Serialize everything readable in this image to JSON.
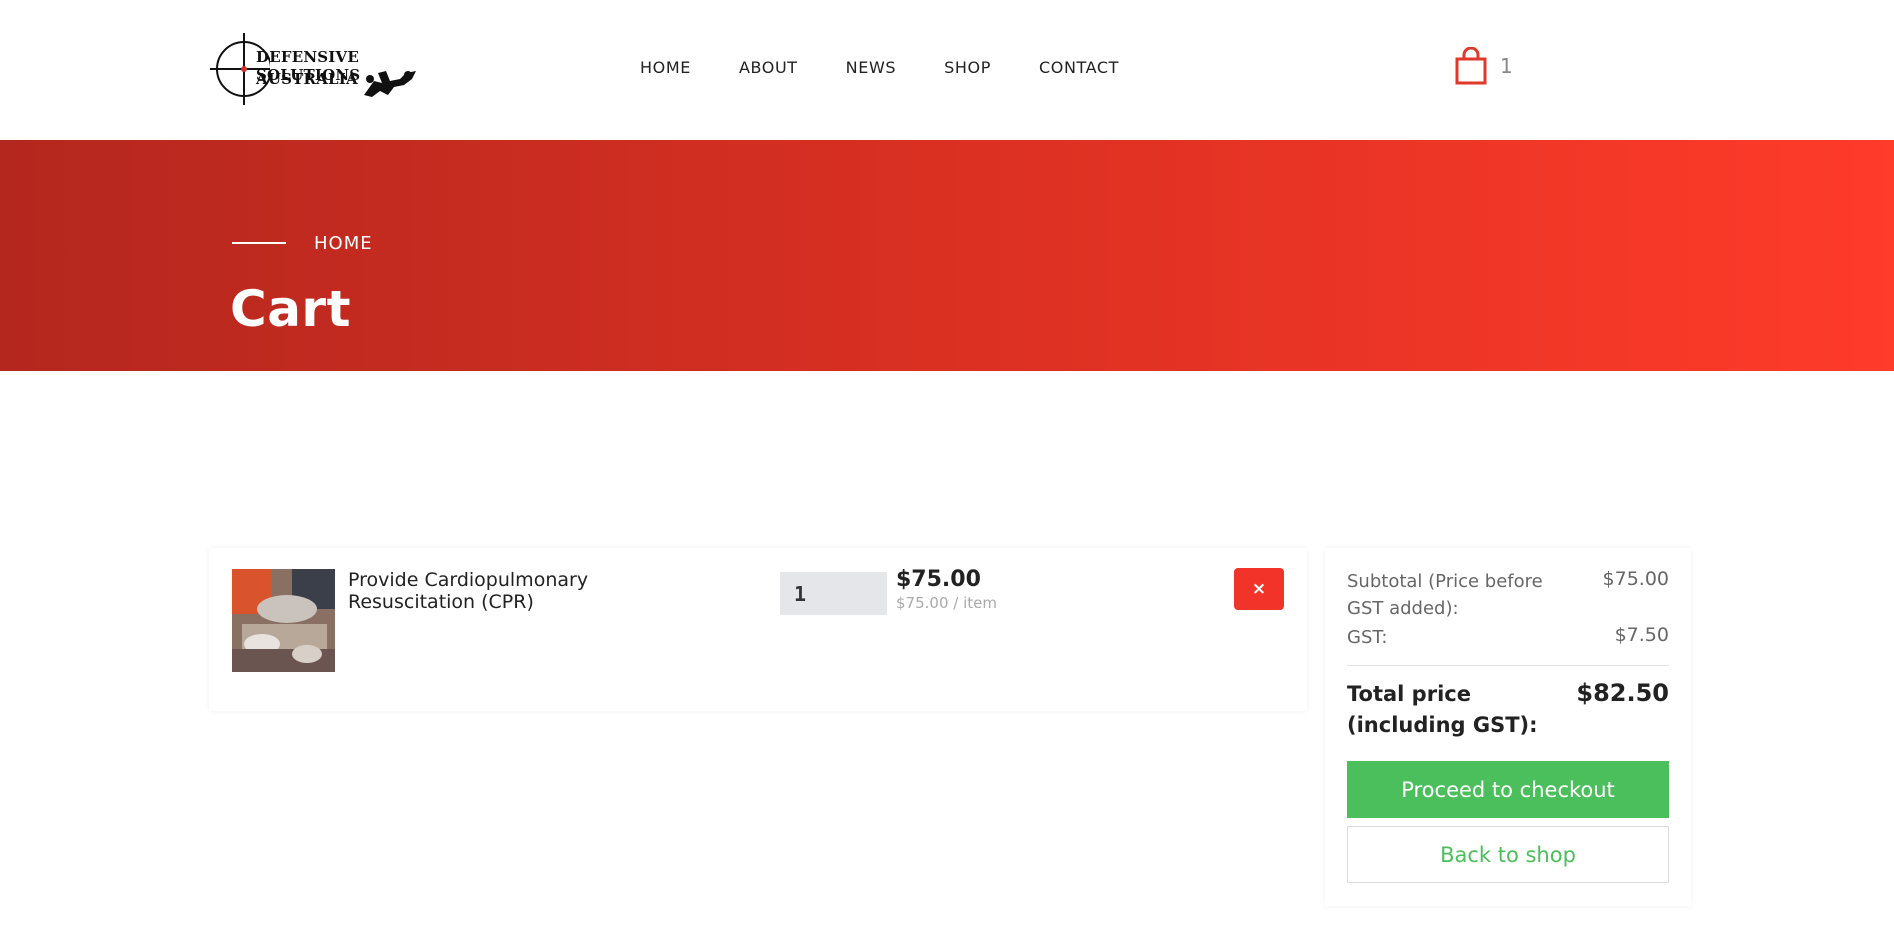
{
  "brand": {
    "line1": "DEFENSIVE SOLUTIONS",
    "line2": "AUSTRALIA"
  },
  "nav": [
    "HOME",
    "ABOUT",
    "NEWS",
    "SHOP",
    "CONTACT"
  ],
  "cart_widget": {
    "icon": "shopping-bag-icon",
    "count": "1"
  },
  "banner": {
    "breadcrumb": "HOME",
    "title": "Cart"
  },
  "cart_items": [
    {
      "name": "Provide Cardiopulmonary Resuscitation (CPR)",
      "quantity": "1",
      "price": "$75.00",
      "unit_price": "$75.00 / item",
      "remove_label": "×"
    }
  ],
  "summary": {
    "subtotal_label": "Subtotal (Price before GST added):",
    "subtotal_value": "$75.00",
    "gst_label": "GST:",
    "gst_value": "$7.50",
    "total_label": "Total price (including GST):",
    "total_value": "$82.50",
    "checkout_label": "Proceed to checkout",
    "back_label": "Back to shop"
  },
  "colors": {
    "accent_red": "#f1332a",
    "banner_start": "#b4271e",
    "banner_end": "#ff3b2a",
    "checkout_green": "#4bbf5b"
  }
}
